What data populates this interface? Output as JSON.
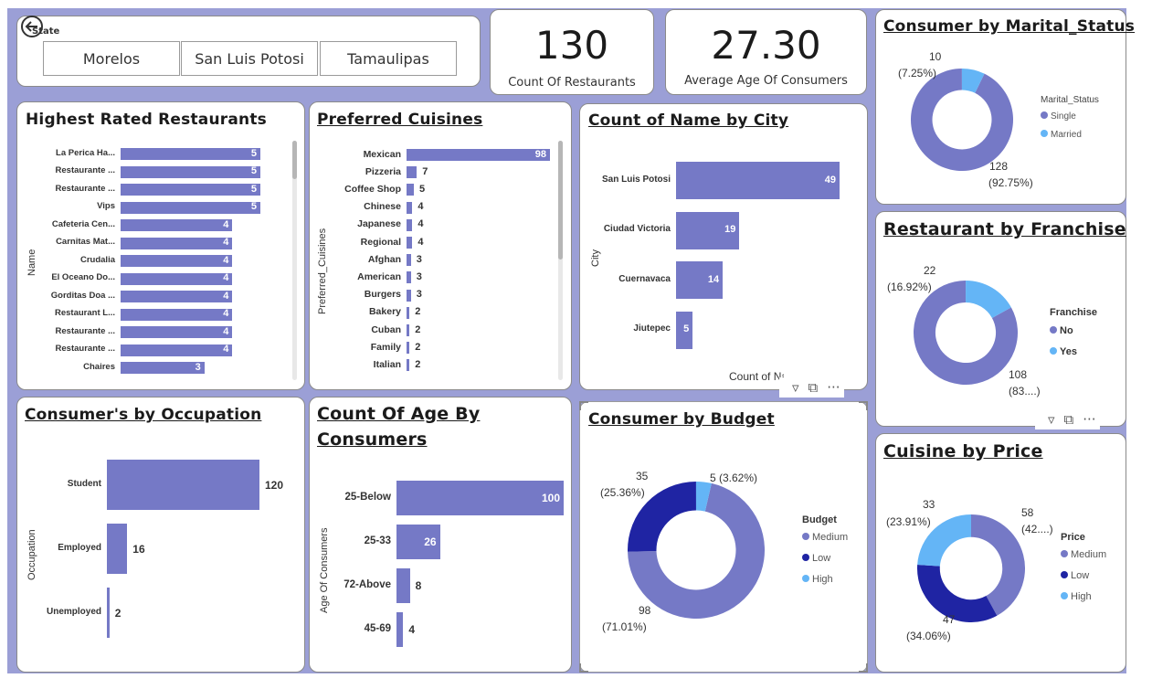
{
  "colors": {
    "canvas": "#9b9fd6",
    "bar": "#7579c6",
    "medium": "#7579c6",
    "low": "#1f24a3",
    "high": "#64b5f6"
  },
  "back_icon": "back-arrow-icon",
  "slicer": {
    "label": "State",
    "items": [
      "Morelos",
      "San Luis Potosi",
      "Tamaulipas"
    ]
  },
  "kpi_restaurants": {
    "value": "130",
    "label": "Count Of Restaurants"
  },
  "kpi_age": {
    "value": "27.30",
    "label": "Average Age Of Consumers"
  },
  "highest_rated": {
    "title": "Highest Rated Restaurants",
    "axis": "Name",
    "chart_data": {
      "type": "bar",
      "categories": [
        "La Perica Ha...",
        "Restaurante ...",
        "Restaurante ...",
        "Vips",
        "Cafeteria Cen...",
        "Carnitas Mat...",
        "Crudalia",
        "El Oceano Do...",
        "Gorditas Doa ...",
        "Restaurant L...",
        "Restaurante ...",
        "Restaurante ...",
        "Chaires"
      ],
      "values": [
        5,
        5,
        5,
        5,
        4,
        4,
        4,
        4,
        4,
        4,
        4,
        4,
        3
      ],
      "max": 5
    }
  },
  "cuisines": {
    "title": "Preferred Cuisines",
    "axis": "Preferred_Cuisines",
    "chart_data": {
      "type": "bar",
      "categories": [
        "Mexican",
        "Pizzeria",
        "Coffee Shop",
        "Chinese",
        "Japanese",
        "Regional",
        "Afghan",
        "American",
        "Burgers",
        "Bakery",
        "Cuban",
        "Family",
        "Italian"
      ],
      "values": [
        98,
        7,
        5,
        4,
        4,
        4,
        3,
        3,
        3,
        2,
        2,
        2,
        2
      ],
      "max": 98
    }
  },
  "city": {
    "title": "Count of Name by City",
    "axis": "City",
    "xlabel": "Count of Name",
    "chart_data": {
      "type": "bar",
      "categories": [
        "San Luis Potosi",
        "Ciudad Victoria",
        "Cuernavaca",
        "Jiutepec"
      ],
      "values": [
        49,
        19,
        14,
        5
      ],
      "max": 49
    }
  },
  "occupation": {
    "title": "Consumer's by Occupation",
    "axis": "Occupation",
    "chart_data": {
      "type": "bar",
      "categories": [
        "Student",
        "Employed",
        "Unemployed"
      ],
      "values": [
        120,
        16,
        2
      ],
      "max": 120
    }
  },
  "age": {
    "title_line1": "Count Of Age By",
    "title_line2": "Consumers",
    "axis": "Age Of Consumers",
    "chart_data": {
      "type": "bar",
      "categories": [
        "25-Below",
        "25-33",
        "72-Above",
        "45-69"
      ],
      "values": [
        100,
        26,
        8,
        4
      ],
      "max": 100
    }
  },
  "marital": {
    "title": "Consumer by Marital_Status",
    "legend_title": "Marital_Status",
    "chart_data": {
      "type": "pie",
      "categories": [
        "Single",
        "Married"
      ],
      "values": [
        128,
        10
      ],
      "percents": [
        "92.75%",
        "7.25%"
      ]
    },
    "labels": {
      "a_val": "128",
      "a_pct": "(92.75%)",
      "b_val": "10",
      "b_pct": "(7.25%)"
    },
    "legend": [
      "Single",
      "Married"
    ]
  },
  "franchise": {
    "title": "Restaurant by Franchise",
    "legend_title": "Franchise",
    "chart_data": {
      "type": "pie",
      "categories": [
        "No",
        "Yes"
      ],
      "values": [
        108,
        22
      ],
      "percents": [
        "83....",
        "16.92%"
      ]
    },
    "labels": {
      "a_val": "108",
      "a_pct": "(83....)",
      "b_val": "22",
      "b_pct": "(16.92%)"
    },
    "legend": [
      "No",
      "Yes"
    ]
  },
  "budget": {
    "title": "Consumer by Budget",
    "legend_title": "Budget",
    "chart_data": {
      "type": "pie",
      "categories": [
        "Medium",
        "Low",
        "High"
      ],
      "values": [
        98,
        35,
        5
      ],
      "percents": [
        "71.01%",
        "25.36%",
        "3.62%"
      ]
    },
    "labels": {
      "a_val": "98",
      "a_pct": "(71.01%)",
      "b_val": "35",
      "b_pct": "(25.36%)",
      "c_label": "5 (3.62%)"
    },
    "legend": [
      "Medium",
      "Low",
      "High"
    ]
  },
  "price": {
    "title": "Cuisine by Price",
    "legend_title": "Price",
    "chart_data": {
      "type": "pie",
      "categories": [
        "Medium",
        "Low",
        "High"
      ],
      "values": [
        58,
        47,
        33
      ],
      "percents": [
        "42....",
        "34.06%",
        "23.91%"
      ]
    },
    "labels": {
      "a_val": "58",
      "a_pct": "(42....)",
      "b_val": "47",
      "b_pct": "(34.06%)",
      "c_val": "33",
      "c_pct": "(23.91%)"
    },
    "legend": [
      "Medium",
      "Low",
      "High"
    ]
  },
  "visual_header_icons": {
    "filter": "filter-icon",
    "focus": "focus-mode-icon",
    "more": "more-options-icon",
    "more_glyph": "···"
  }
}
